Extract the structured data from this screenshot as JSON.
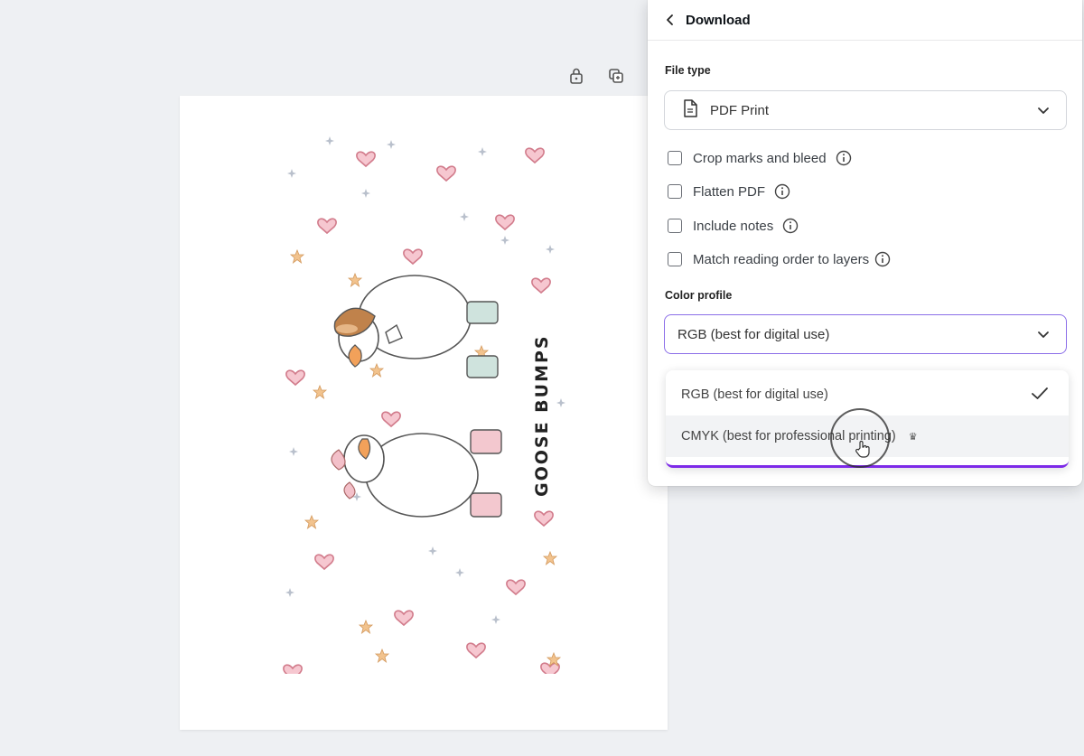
{
  "panel": {
    "title": "Download",
    "file_type": {
      "label": "File type",
      "value": "PDF Print"
    },
    "options": [
      {
        "label": "Crop marks and bleed",
        "checked": false
      },
      {
        "label": "Flatten PDF",
        "checked": false
      },
      {
        "label": "Include notes",
        "checked": false
      },
      {
        "label": "Match reading order to layers",
        "checked": false
      }
    ],
    "color_profile": {
      "label": "Color profile",
      "value": "RGB (best for digital use)",
      "menu": [
        {
          "label": "RGB (best for digital use)",
          "selected": true
        },
        {
          "label": "CMYK (best for professional printing)",
          "selected": false,
          "hovered": true
        }
      ]
    }
  },
  "canvas": {
    "artwork_text": "GOOSE BUMPS"
  },
  "colors": {
    "accent": "#7d2ae8",
    "focus_border": "#8b6ee8",
    "heart": "#f3b4c0",
    "star": "#f0c290",
    "canvas_bg": "#eef0f3"
  },
  "icons": {
    "back": "chevron-left-icon",
    "lock": "lock-icon",
    "duplicate": "duplicate-icon",
    "file": "file-pdf-icon",
    "dropdown": "chevron-down-icon",
    "info": "info-icon",
    "selected": "checkmark-icon",
    "pointer": "hand-pointer-icon"
  }
}
